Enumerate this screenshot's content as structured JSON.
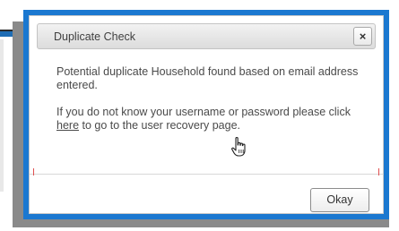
{
  "dialog": {
    "title": "Duplicate Check",
    "close_label": "×",
    "message_1": "Potential duplicate Household found based on email address entered.",
    "message_2_before": "If you do not know your username or password please click ",
    "message_2_link": "here",
    "message_2_after": " to go to the user recovery page.",
    "okay_label": "Okay"
  },
  "colors": {
    "frame_accent": "#1b78d0",
    "shadow": "#8a8a8a"
  },
  "icons": {
    "close": "close-icon",
    "cursor": "hand-pointer-icon"
  }
}
